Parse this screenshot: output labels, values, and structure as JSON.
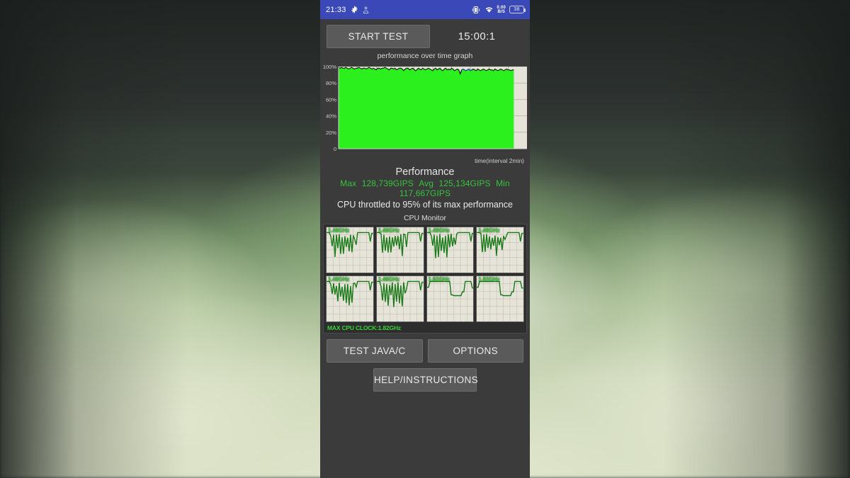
{
  "statusbar": {
    "time": "21:33",
    "gear_icon": "gear-icon",
    "app_icon": "app-badge-icon",
    "vibrate_icon": "vibrate-icon",
    "wifi_icon": "wifi-icon",
    "netspeed_value": "0.00",
    "netspeed_unit": "B/S",
    "battery_level": "38",
    "bg_color": "#3b49b8"
  },
  "toolbar": {
    "start_test_label": "START TEST",
    "timer": "15:00:1"
  },
  "chart_data": {
    "type": "area",
    "title": "performance over time graph",
    "xlabel": "time(interval 2min)",
    "ylabel": "",
    "ylim": [
      0,
      100
    ],
    "ytick_labels": [
      "100%",
      "80%",
      "60%",
      "40%",
      "20%",
      "0"
    ],
    "ytick_values": [
      100,
      80,
      60,
      40,
      20,
      0
    ],
    "grid": true,
    "plot_bg_color": "#e6e4d8",
    "fill_color": "#2bf01e",
    "line_color": "#111111",
    "highlight_color": "#2a3fd0",
    "x_fraction_filled": 0.93,
    "series": [
      {
        "name": "performance",
        "values": [
          99,
          98,
          99,
          98,
          98,
          99,
          98,
          97,
          98,
          99,
          98,
          97,
          98,
          98,
          99,
          98,
          97,
          98,
          98,
          97,
          98,
          99,
          98,
          97,
          98,
          97,
          96,
          98,
          98,
          97,
          98,
          98,
          99,
          98,
          97,
          96,
          98,
          98,
          97,
          98,
          96,
          97,
          98,
          98,
          97,
          95,
          97,
          98,
          98,
          96,
          97,
          98,
          97,
          95,
          96,
          98,
          97,
          96,
          98,
          97,
          96,
          97,
          98,
          97,
          96,
          95,
          97,
          98,
          96,
          97,
          98,
          96,
          95,
          97,
          98,
          96,
          97,
          96,
          98,
          97,
          95,
          96,
          97,
          96,
          91,
          96,
          97,
          96,
          95,
          96,
          97,
          95,
          96,
          97,
          96,
          95,
          97,
          96,
          95,
          96,
          97,
          96,
          95,
          96,
          97,
          96,
          96,
          95,
          97,
          96,
          95,
          96,
          97,
          96,
          95,
          96,
          97,
          96,
          96,
          95,
          96,
          96
        ]
      }
    ]
  },
  "performance": {
    "heading": "Performance",
    "max_label": "Max",
    "max_value": "128,739GIPS",
    "avg_label": "Avg",
    "avg_value": "125,134GIPS",
    "min_label": "Min",
    "min_value": "117,667GIPS",
    "throttle_text": "CPU throttled to 95% of its max performance",
    "stats_color": "#35c43a"
  },
  "cpu_monitor": {
    "title": "CPU Monitor",
    "max_clock_text": "MAX CPU CLOCK:1.82GHz",
    "label_color": "#3ad13a",
    "graph_bg_color": "#e6e4d8",
    "graph_line_color": "#1a7a1a",
    "cores": [
      {
        "label": "1.48GHz",
        "pattern": "spiky"
      },
      {
        "label": "1.48GHz",
        "pattern": "spiky"
      },
      {
        "label": "1.48GHz",
        "pattern": "spiky"
      },
      {
        "label": "1.48GHz",
        "pattern": "spiky"
      },
      {
        "label": "1.48GHz",
        "pattern": "spiky"
      },
      {
        "label": "1.48GHz",
        "pattern": "spiky"
      },
      {
        "label": "1.82GHz",
        "pattern": "plateau"
      },
      {
        "label": "1.82GHz",
        "pattern": "plateau"
      }
    ]
  },
  "buttons": {
    "test_java_c": "TEST JAVA/C",
    "options": "OPTIONS",
    "help_instructions": "HELP/INSTRUCTIONS"
  }
}
